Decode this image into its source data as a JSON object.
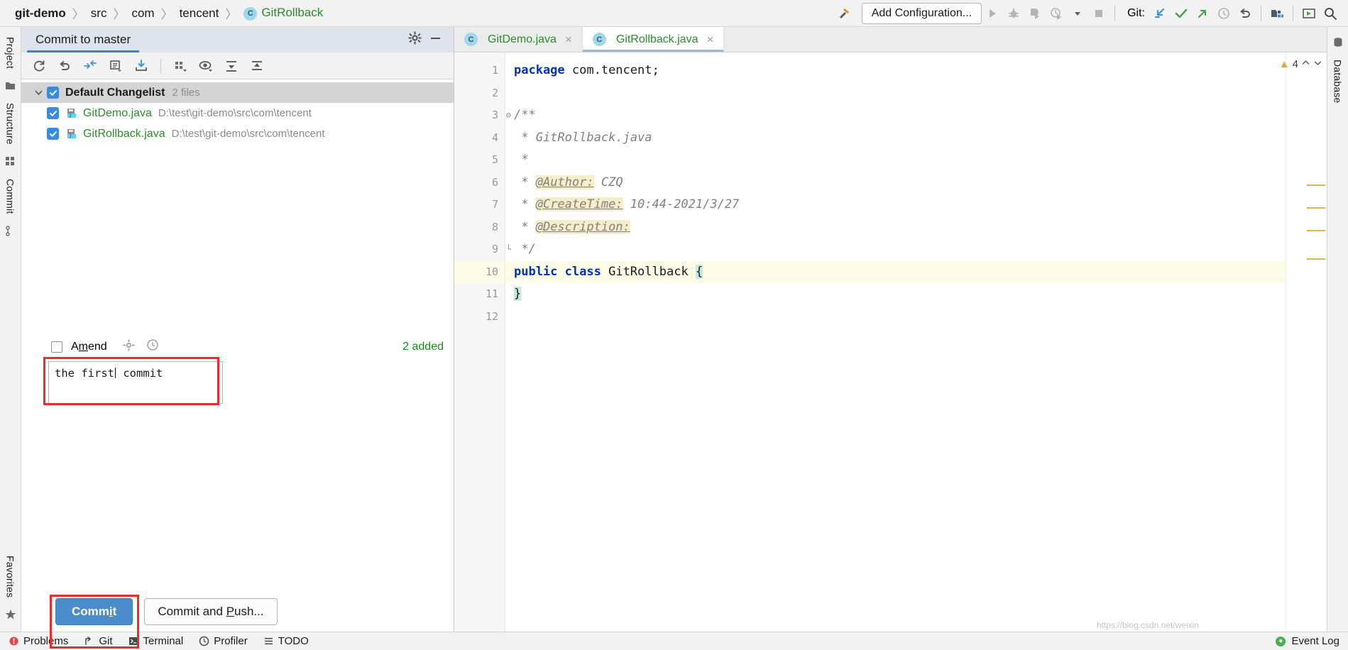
{
  "breadcrumb": {
    "items": [
      {
        "label": "git-demo",
        "style": "bold"
      },
      {
        "label": "src",
        "style": "plain"
      },
      {
        "label": "com",
        "style": "plain"
      },
      {
        "label": "tencent",
        "style": "plain"
      },
      {
        "label": "GitRollback",
        "style": "class",
        "icon": "C"
      }
    ],
    "separator": "〉"
  },
  "toolbar": {
    "hammer_icon": "build-hammer-icon",
    "add_configuration": "Add Configuration...",
    "run_icon": "run-icon",
    "debug_icon": "debug-icon",
    "run_coverage_icon": "run-with-coverage-icon",
    "profile_icon": "profile-icon",
    "dropdown_icon": "chevron-down-icon",
    "stop_icon": "stop-icon",
    "git_label": "Git:",
    "git_update_icon": "git-update-project-icon",
    "git_commit_icon": "git-commit-icon",
    "git_push_icon": "git-push-icon",
    "git_history_icon": "git-history-icon",
    "git_rollback_icon": "git-rollback-icon",
    "project_structure_icon": "project-structure-icon",
    "run_anything_icon": "run-anything-icon",
    "search_icon": "search-everywhere-icon"
  },
  "left_strip": {
    "project_tab": "Project",
    "structure_tab": "Structure",
    "commit_tab": "Commit",
    "favorites_tab": "Favorites",
    "folder_icon": "folder-icon",
    "module_icon": "module-icon",
    "branch_icon": "git-branch-icon",
    "star_icon": "star-icon"
  },
  "right_strip": {
    "database_tab": "Database",
    "database_icon": "database-icon"
  },
  "commit_panel": {
    "title": "Commit to master",
    "settings_icon": "gear-icon",
    "hide_icon": "minimize-icon",
    "toolbar_icons": [
      "refresh-changes-icon",
      "rollback-icon",
      "show-diff-icon",
      "edit-message-icon",
      "update-icon",
      "group-by-icon",
      "preview-diff-icon",
      "expand-all-icon",
      "collapse-all-icon"
    ],
    "changelist": {
      "expand_icon": "chevron-down-icon",
      "checked": true,
      "name": "Default Changelist",
      "count": "2 files"
    },
    "files": [
      {
        "checked": true,
        "icon": "java-file-icon",
        "name": "GitDemo.java",
        "path": "D:\\test\\git-demo\\src\\com\\tencent"
      },
      {
        "checked": true,
        "icon": "java-file-icon",
        "name": "GitRollback.java",
        "path": "D:\\test\\git-demo\\src\\com\\tencent"
      }
    ],
    "amend": {
      "label_pre": "A",
      "label_mnemonic": "m",
      "label_post": "end",
      "checked": false,
      "gear_icon": "commit-options-icon",
      "history_icon": "message-history-icon"
    },
    "added_status": "2 added",
    "message_value": "the first commit",
    "message_caret_after": "the first",
    "message_caret_rest": " commit",
    "commit_button": {
      "pre": "Comm",
      "mnemonic": "i",
      "post": "t"
    },
    "commit_push_button": {
      "pre": "Commit and ",
      "mnemonic": "P",
      "post": "ush..."
    }
  },
  "editor": {
    "tabs": [
      {
        "icon": "C",
        "label": "GitDemo.java",
        "close": "×",
        "active": false
      },
      {
        "icon": "C",
        "label": "GitRollback.java",
        "close": "×",
        "active": true
      }
    ],
    "line_numbers": [
      "1",
      "2",
      "3",
      "4",
      "5",
      "6",
      "7",
      "8",
      "9",
      "10",
      "11",
      "12"
    ],
    "current_line": 10,
    "code_lines": [
      {
        "n": 1,
        "segments": [
          {
            "t": "package",
            "c": "kw"
          },
          {
            "t": " com.tencent;",
            "c": ""
          }
        ]
      },
      {
        "n": 2,
        "segments": []
      },
      {
        "n": 3,
        "segments": [
          {
            "t": "/**",
            "c": "cm"
          }
        ],
        "fold": true
      },
      {
        "n": 4,
        "segments": [
          {
            "t": " * GitRollback.java",
            "c": "cm"
          }
        ]
      },
      {
        "n": 5,
        "segments": [
          {
            "t": " *",
            "c": "cm"
          }
        ]
      },
      {
        "n": 6,
        "segments": [
          {
            "t": " * ",
            "c": "cm"
          },
          {
            "t": "@Author:",
            "c": "tag"
          },
          {
            "t": " CZQ",
            "c": "cm"
          }
        ]
      },
      {
        "n": 7,
        "segments": [
          {
            "t": " * ",
            "c": "cm"
          },
          {
            "t": "@CreateTime:",
            "c": "tag"
          },
          {
            "t": " 10:44-2021/3/27",
            "c": "cm"
          }
        ]
      },
      {
        "n": 8,
        "segments": [
          {
            "t": " * ",
            "c": "cm"
          },
          {
            "t": "@Description:",
            "c": "tag"
          }
        ]
      },
      {
        "n": 9,
        "segments": [
          {
            "t": " */",
            "c": "cm"
          }
        ],
        "fold_end": true
      },
      {
        "n": 10,
        "segments": [
          {
            "t": "public",
            "c": "kw"
          },
          {
            "t": " ",
            "c": ""
          },
          {
            "t": "class",
            "c": "kw"
          },
          {
            "t": " GitRollback ",
            "c": ""
          },
          {
            "t": "{",
            "c": "hl"
          }
        ],
        "current": true
      },
      {
        "n": 11,
        "segments": [
          {
            "t": "}",
            "c": "hl"
          }
        ]
      },
      {
        "n": 12,
        "segments": []
      }
    ],
    "inspection": {
      "warning_icon": "warning-triangle-icon",
      "warning_count": "4",
      "up_icon": "chevron-up-icon",
      "down_icon": "chevron-down-icon"
    }
  },
  "status_bar": {
    "items": [
      {
        "icon": "problems-icon",
        "label": "Problems"
      },
      {
        "icon": "git-icon",
        "label": "Git"
      },
      {
        "icon": "terminal-icon",
        "label": "Terminal"
      },
      {
        "icon": "profiler-icon",
        "label": "Profiler"
      },
      {
        "icon": "todo-icon",
        "label": "TODO"
      }
    ],
    "event_log": "Event Log",
    "event_log_icon": "event-log-icon"
  },
  "watermark": "https://blog.csdn.net/weixin"
}
